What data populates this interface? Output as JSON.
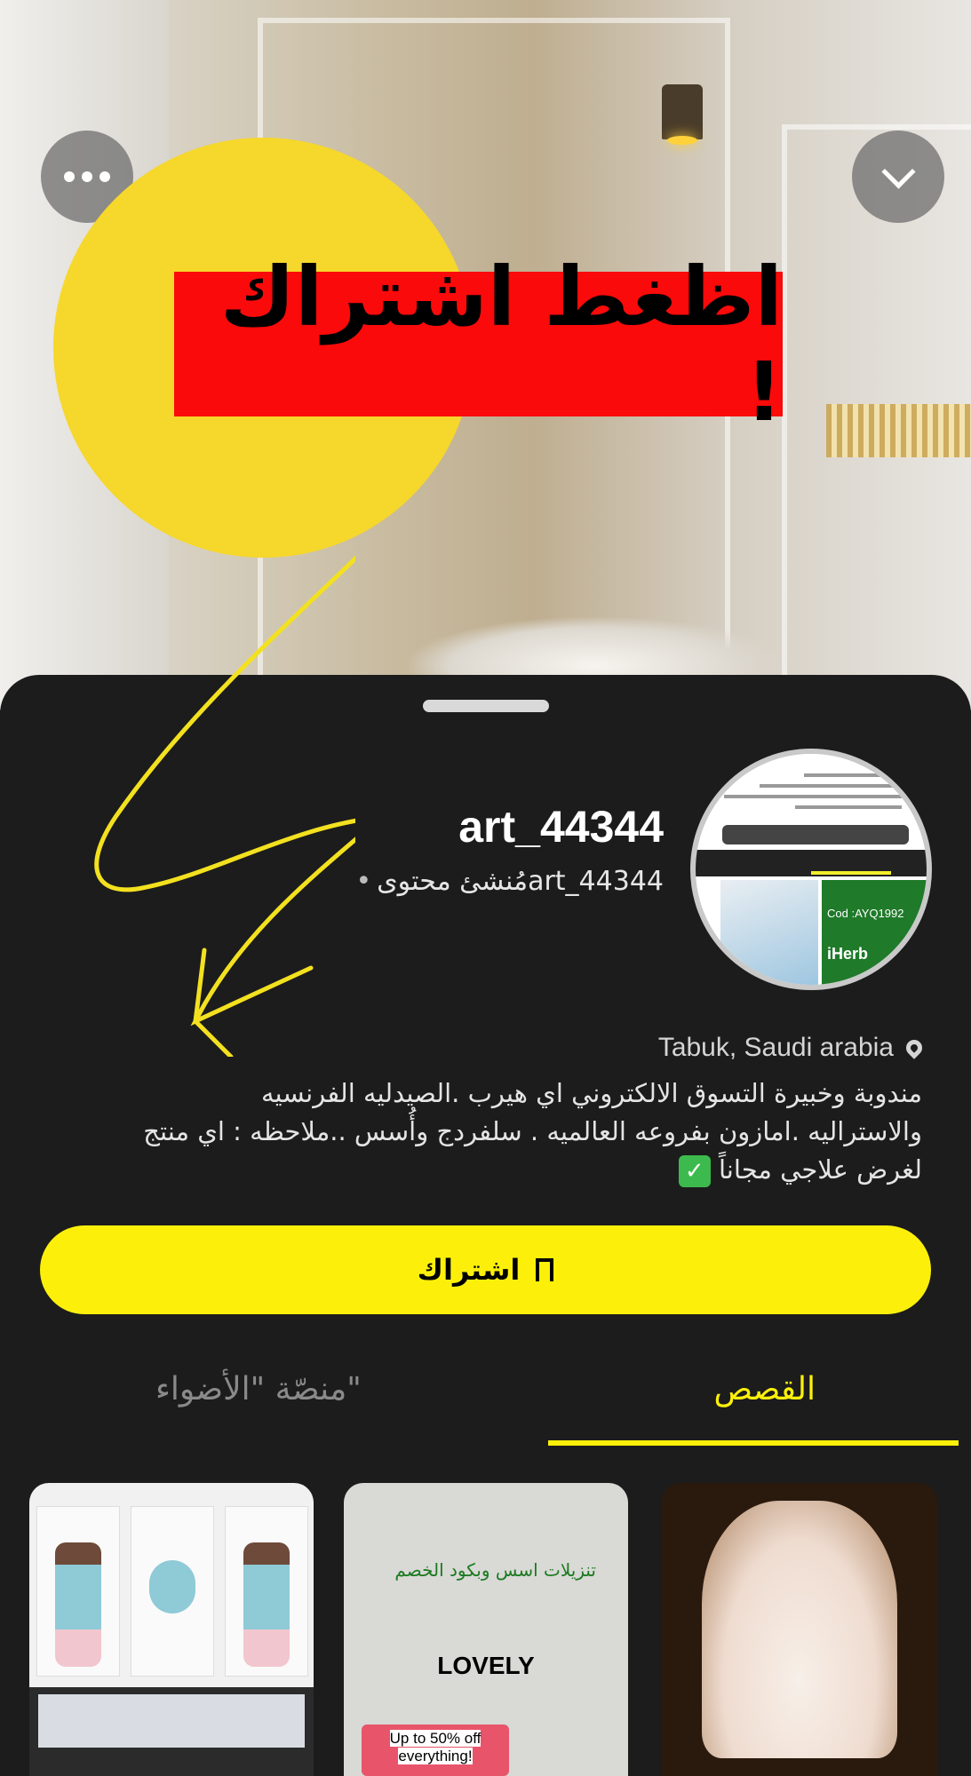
{
  "overlay": {
    "banner_text": "اظغط اشتراك !"
  },
  "profile": {
    "username": "art_44344",
    "subtitle": "art_44344مُنشئ محتوى",
    "location": "Tabuk, Saudi arabia",
    "bio_lines": [
      "مندوبة وخبيرة التسوق الالكتروني  اي هيرب .الصيدليه الفرنسيه",
      "والاستراليه  .امازون بفروعه العالميه . سلفردج وأُسس ..ملاحظه : اي منتج",
      "لغرض علاجي مجاناً"
    ],
    "avatar": {
      "cod_text": "Cod :AYQ1992",
      "brand_text": "iHerb"
    }
  },
  "actions": {
    "subscribe_label": "اشتراك"
  },
  "tabs": [
    {
      "label": "القصص",
      "active": true
    },
    {
      "label": "منصّة \"الأضواء\"",
      "active": false
    }
  ],
  "tiles": {
    "tile2": {
      "arabic_caption": "تنزيلات اسس وبكود الخصم",
      "brand": "LOVELY",
      "promo_line1": "Up to 50% off",
      "promo_line2": "everything!"
    }
  },
  "colors": {
    "accent": "#fcf00a",
    "banner_red": "#fa0a0a",
    "circle_yellow": "#f6d72b",
    "sheet_bg": "#1c1c1c"
  }
}
